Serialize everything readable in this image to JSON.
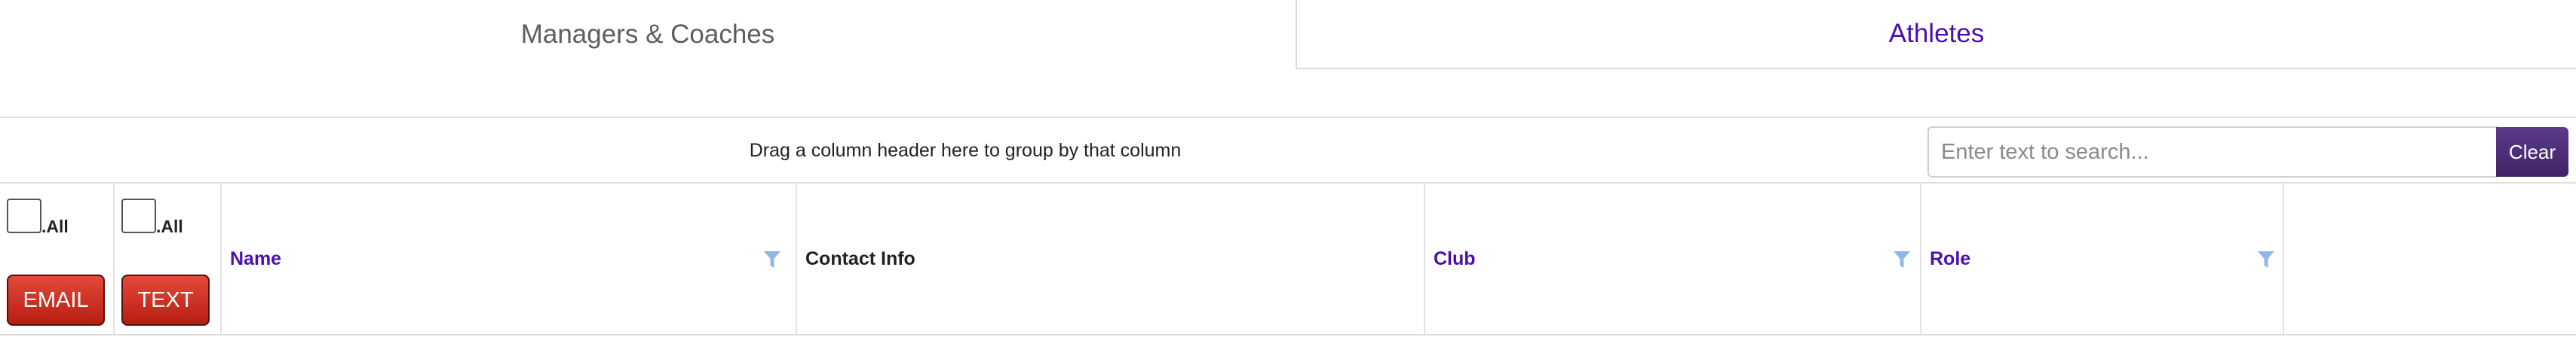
{
  "tabs": {
    "managers_coaches": "Managers & Coaches",
    "athletes": "Athletes"
  },
  "group_panel": {
    "hint": "Drag a column header here to group by that column"
  },
  "search": {
    "placeholder": "Enter text to search...",
    "value": "",
    "clear_label": "Clear"
  },
  "columns": {
    "email": {
      "select_all_label": ".All",
      "button_label": "EMAIL"
    },
    "text": {
      "select_all_label": ".All",
      "button_label": "TEXT"
    },
    "name": "Name",
    "contact_info": "Contact Info",
    "club": "Club",
    "role": "Role"
  },
  "icons": {
    "filter": "filter-icon"
  },
  "colors": {
    "accent_purple": "#4a0fb3",
    "button_red": "#c9281b",
    "clear_button": "#4b2d75",
    "filter_icon": "#8fb8e8"
  }
}
